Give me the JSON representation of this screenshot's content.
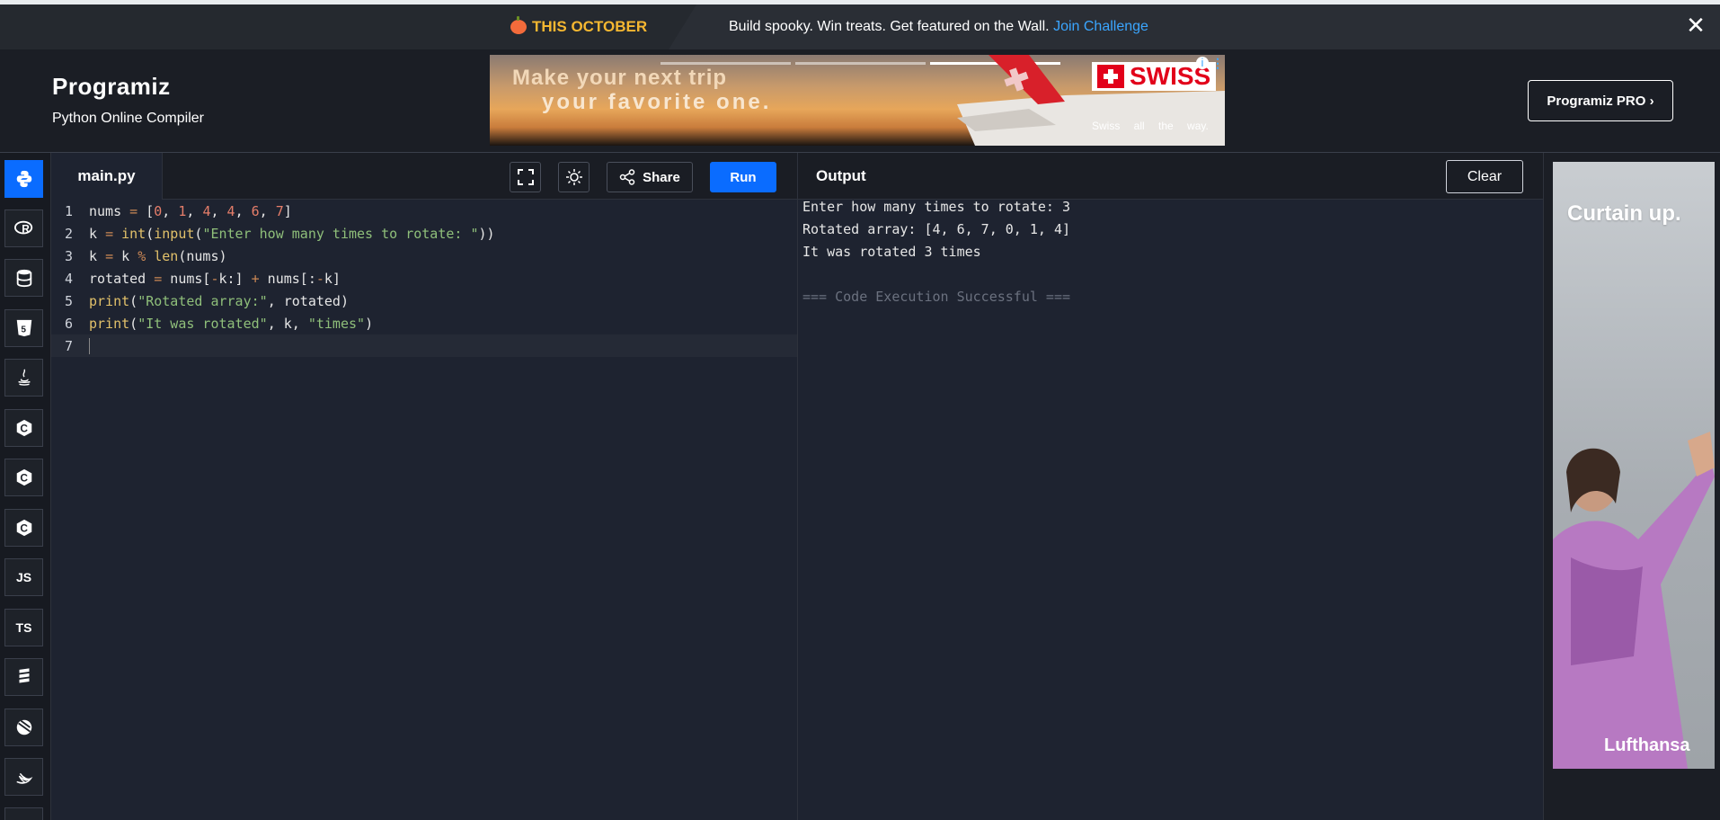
{
  "promo": {
    "tag": "THIS OCTOBER",
    "message": "Build spooky. Win treats. Get featured on the Wall.",
    "link": "Join Challenge",
    "close": "✕"
  },
  "header": {
    "logo": "Programiz",
    "subtitle": "Python Online Compiler",
    "pro_button": "Programiz PRO ›"
  },
  "ad_top": {
    "line1": "Make your next trip",
    "line2": "your favorite one.",
    "brand": "SWISS",
    "tagline": "Swiss all the way."
  },
  "sidebar": {
    "items": [
      {
        "name": "python",
        "label": ""
      },
      {
        "name": "r",
        "label": "R"
      },
      {
        "name": "sql",
        "label": ""
      },
      {
        "name": "html",
        "label": "5"
      },
      {
        "name": "java",
        "label": ""
      },
      {
        "name": "c",
        "label": "C"
      },
      {
        "name": "cpp",
        "label": "C"
      },
      {
        "name": "csharp",
        "label": "C"
      },
      {
        "name": "js",
        "label": "JS"
      },
      {
        "name": "ts",
        "label": "TS"
      },
      {
        "name": "go",
        "label": ""
      },
      {
        "name": "php",
        "label": ""
      },
      {
        "name": "swift",
        "label": ""
      }
    ]
  },
  "editor": {
    "filename": "main.py",
    "share_label": "Share",
    "run_label": "Run",
    "line_numbers": [
      "1",
      "2",
      "3",
      "4",
      "5",
      "6",
      "7"
    ]
  },
  "output": {
    "title": "Output",
    "clear_label": "Clear",
    "lines": [
      "Enter how many times to rotate: 3",
      "Rotated array: [4, 6, 7, 0, 1, 4]",
      "It was rotated 3 times",
      "",
      "=== Code Execution Successful ==="
    ]
  },
  "ad_side": {
    "title": "Curtain up.",
    "brand": "Lufthansa"
  },
  "colors": {
    "accent": "#0a6cff",
    "promo_tag": "#f5b731",
    "link": "#3ba6ff",
    "editor_bg": "#1e2330"
  }
}
